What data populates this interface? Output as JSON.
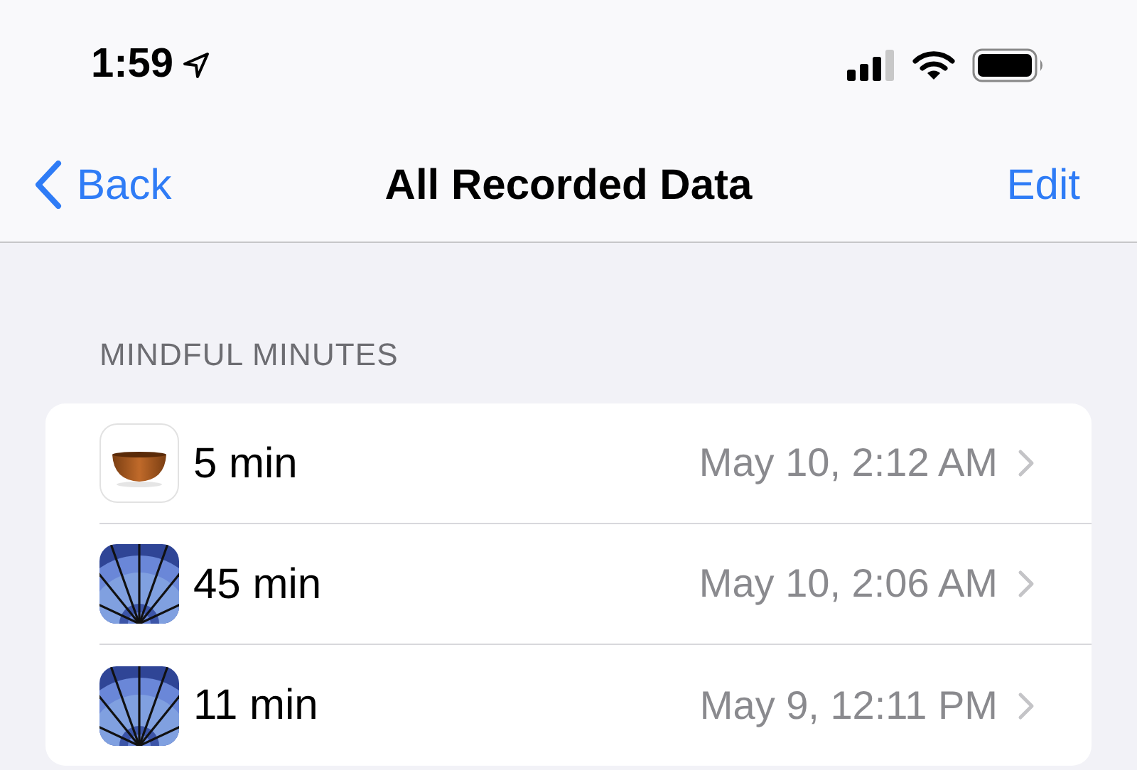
{
  "status_bar": {
    "time": "1:59"
  },
  "nav_bar": {
    "back": "Back",
    "title": "All Recorded Data",
    "action": "Edit"
  },
  "section": {
    "header": "MINDFUL MINUTES",
    "rows": [
      {
        "kind": "bowl",
        "value": "5 min",
        "date": "May 10, 2:12 AM"
      },
      {
        "kind": "sunburst",
        "value": "45 min",
        "date": "May 10, 2:06 AM"
      },
      {
        "kind": "sunburst",
        "value": "11 min",
        "date": "May 9, 12:11 PM"
      }
    ]
  }
}
